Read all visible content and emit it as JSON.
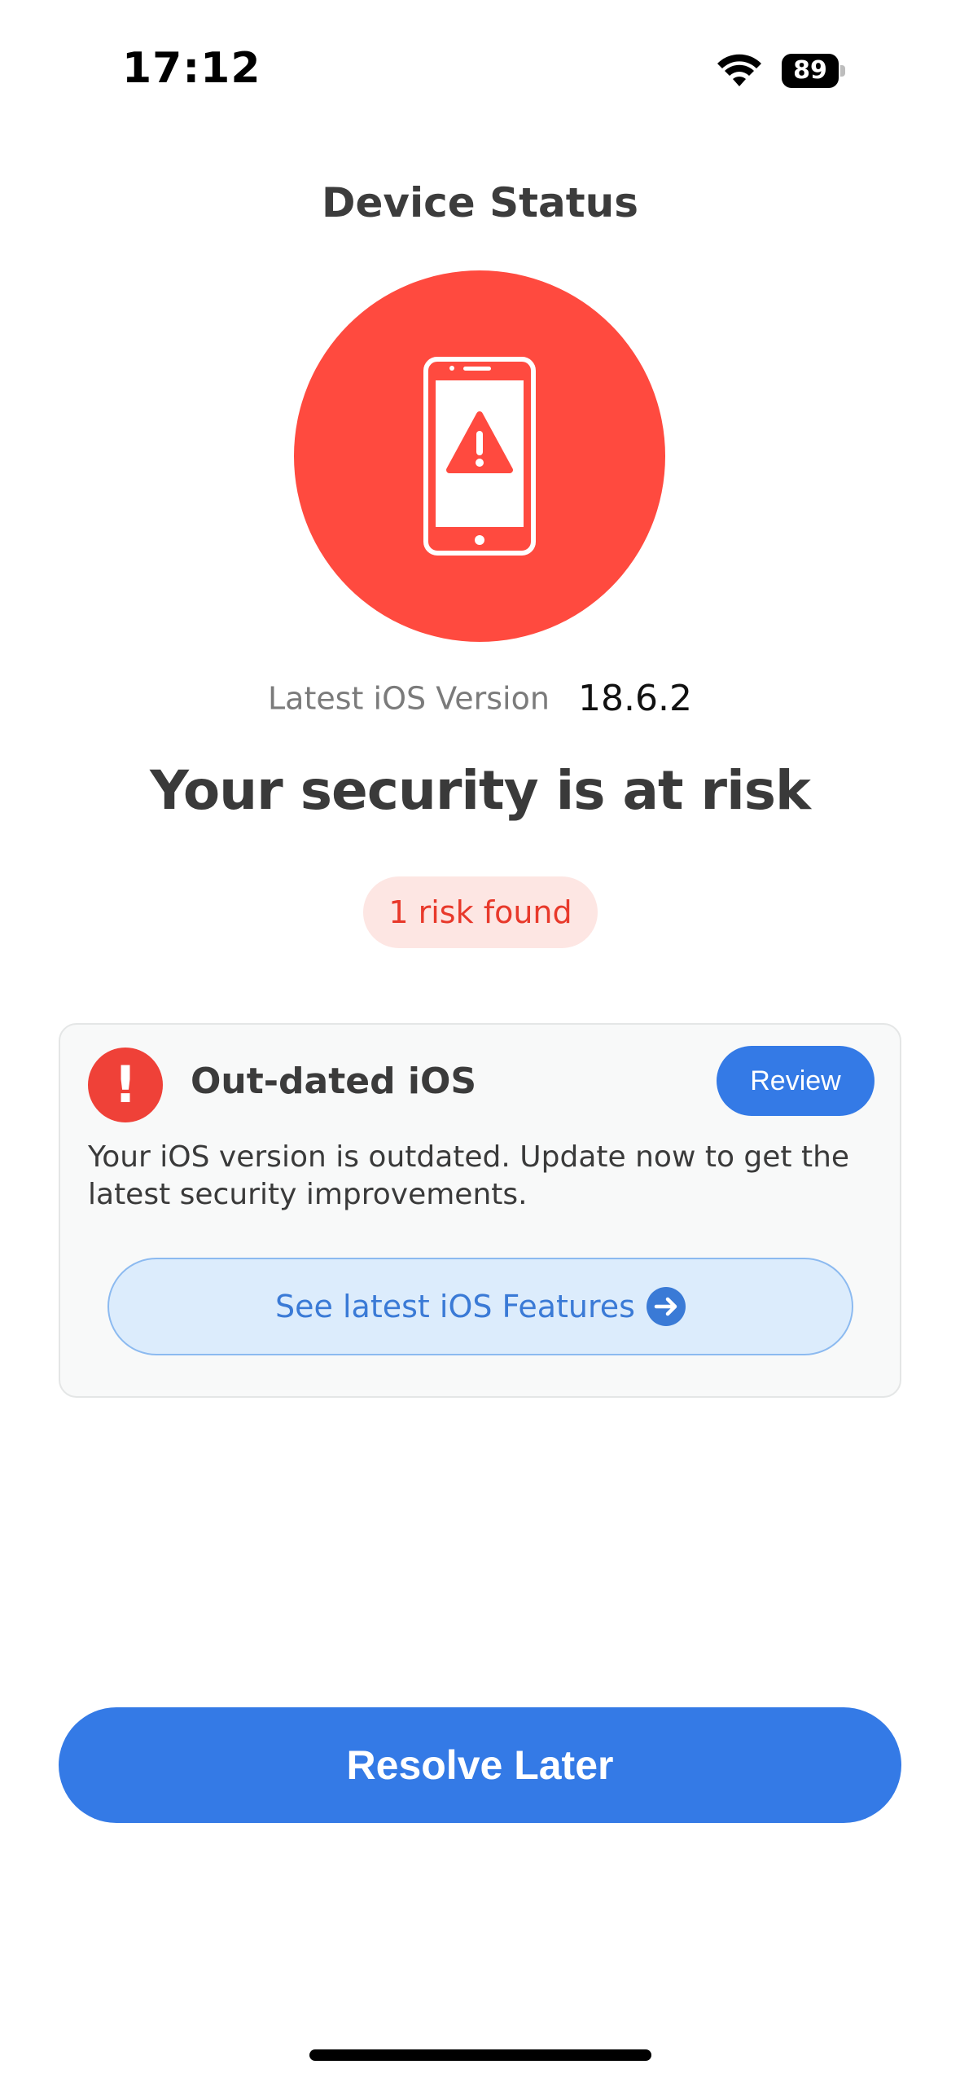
{
  "status_bar": {
    "time": "17:12",
    "battery_level": "89",
    "wifi_icon": "wifi-icon",
    "battery_icon": "battery-icon"
  },
  "page": {
    "title": "Device Status"
  },
  "hero": {
    "icon": "phone-warning-icon",
    "color": "#ff4a3f"
  },
  "version": {
    "label": "Latest iOS Version",
    "value": "18.6.2"
  },
  "headline": "Your security is at risk",
  "risk_badge": "1 risk found",
  "risk_card": {
    "alert_icon": "exclamation-icon",
    "alert_glyph": "!",
    "title": "Out-dated iOS",
    "review_label": "Review",
    "description": "Your iOS version is outdated. Update now to get the latest security improvements.",
    "features_label": "See latest iOS Features",
    "features_icon": "arrow-right-circle-icon"
  },
  "resolve_label": "Resolve Later",
  "colors": {
    "accent_blue": "#347ae6",
    "danger_red": "#ef4138",
    "badge_bg": "#fde6e3"
  }
}
